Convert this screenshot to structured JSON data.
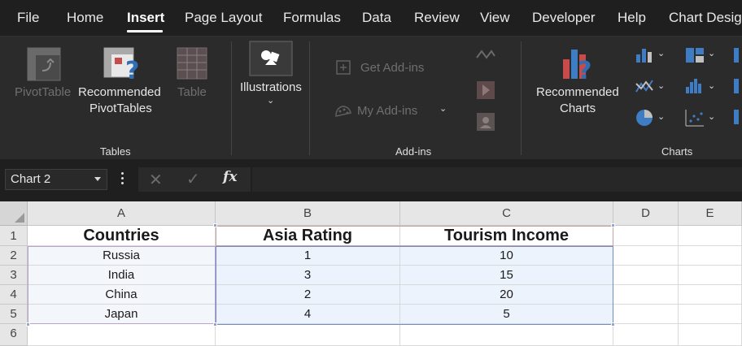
{
  "menu": {
    "items": [
      "File",
      "Home",
      "Insert",
      "Page Layout",
      "Formulas",
      "Data",
      "Review",
      "View",
      "Developer",
      "Help",
      "Chart Desig"
    ],
    "active": "Insert"
  },
  "ribbon": {
    "tables": {
      "label": "Tables",
      "pivot_table": "PivotTable",
      "recommended_pivot_line1": "Recommended",
      "recommended_pivot_line2": "PivotTables",
      "table": "Table"
    },
    "illustrations": {
      "label": "Illustrations"
    },
    "addins": {
      "label": "Add-ins",
      "get_addins": "Get Add-ins",
      "my_addins": "My Add-ins"
    },
    "charts": {
      "label": "Charts",
      "recommended_line1": "Recommended",
      "recommended_line2": "Charts"
    }
  },
  "formula_bar": {
    "name_box": "Chart 2",
    "fx": "fx",
    "formula": ""
  },
  "grid": {
    "columns": [
      "A",
      "B",
      "C",
      "D",
      "E"
    ],
    "rows": [
      "1",
      "2",
      "3",
      "4",
      "5",
      "6"
    ],
    "headers": [
      "Countries",
      "Asia Rating",
      "Tourism Income"
    ],
    "data": [
      [
        "Russia",
        "1",
        "10"
      ],
      [
        "India",
        "3",
        "15"
      ],
      [
        "China",
        "2",
        "20"
      ],
      [
        "Japan",
        "4",
        "5"
      ]
    ]
  },
  "colors": {
    "ribbon_bg": "#2b2b2b",
    "menu_bg": "#1f1f1f",
    "selection_blue": "#6f8fc3",
    "series_red": "#c9a0a0",
    "category_purple": "#b9a3c9"
  },
  "icons": [
    "pivot-table-icon",
    "recommended-pivot-icon",
    "table-icon",
    "illustrations-icon",
    "get-addins-icon",
    "my-addins-icon",
    "visio-icon",
    "bing-icon",
    "people-graph-icon",
    "recommended-charts-icon",
    "column-chart-icon",
    "hierarchy-chart-icon",
    "line-chart-icon",
    "statistic-chart-icon",
    "pie-chart-icon",
    "scatter-chart-icon",
    "fx-icon"
  ]
}
